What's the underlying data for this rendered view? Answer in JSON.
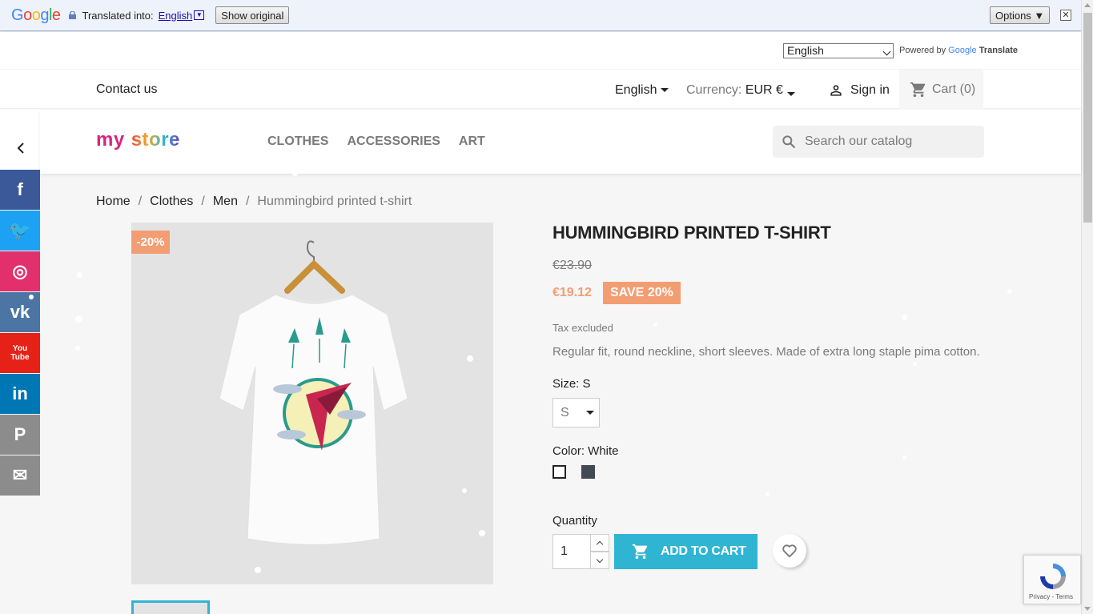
{
  "translate_bar": {
    "logo_letters": [
      {
        "ch": "G",
        "color": "#4285F4"
      },
      {
        "ch": "o",
        "color": "#EA4335"
      },
      {
        "ch": "o",
        "color": "#FBBC05"
      },
      {
        "ch": "g",
        "color": "#4285F4"
      },
      {
        "ch": "l",
        "color": "#34A853"
      },
      {
        "ch": "e",
        "color": "#EA4335"
      }
    ],
    "translated_into": "Translated into:",
    "language": "English",
    "show_original": "Show original",
    "options": "Options ▼",
    "close": "✕"
  },
  "translate_widget": {
    "selected_language": "English",
    "powered_by": "Powered by",
    "google": "Google",
    "translate": "Translate"
  },
  "header_nav": {
    "contact": "Contact us",
    "language": "English",
    "currency_label": "Currency:",
    "currency_value": "EUR €",
    "sign_in": "Sign in",
    "cart": "Cart (0)"
  },
  "logo": {
    "part1": "my",
    "part2": "store"
  },
  "menu": [
    "CLOTHES",
    "ACCESSORIES",
    "ART"
  ],
  "search": {
    "placeholder": "Search our catalog"
  },
  "social": [
    {
      "name": "facebook",
      "glyph": "f",
      "color": "#3b5998"
    },
    {
      "name": "twitter",
      "glyph": "🐦",
      "color": "#1da1f2"
    },
    {
      "name": "instagram",
      "glyph": "◎",
      "color": "#e1306c"
    },
    {
      "name": "vk",
      "glyph": "vk",
      "color": "#4c75a3"
    },
    {
      "name": "youtube",
      "glyph": "You\nTube",
      "color": "#e62117"
    },
    {
      "name": "linkedin",
      "glyph": "in",
      "color": "#0077b5"
    },
    {
      "name": "pinterest",
      "glyph": "P",
      "color": "#8c8c8c"
    },
    {
      "name": "email",
      "glyph": "✉",
      "color": "#8c8c8c"
    }
  ],
  "breadcrumb": {
    "items": [
      "Home",
      "Clothes",
      "Men"
    ],
    "separator": "/",
    "current": "Hummingbird printed t-shirt"
  },
  "product": {
    "discount_badge": "-20%",
    "title": "HUMMINGBIRD PRINTED T-SHIRT",
    "old_price": "€23.90",
    "price": "€19.12",
    "save_label": "SAVE 20%",
    "tax": "Tax excluded",
    "description": "Regular fit, round neckline, short sleeves. Made of extra long staple pima cotton.",
    "size_label": "Size: S",
    "size_value": "S",
    "color_label": "Color: White",
    "colors": [
      {
        "name": "White",
        "hex": "#ffffff"
      },
      {
        "name": "Black",
        "hex": "#434a54"
      }
    ],
    "quantity_label": "Quantity",
    "quantity": "1",
    "add_to_cart": "ADD TO CART"
  },
  "recaptcha": {
    "links": "Privacy - Terms"
  }
}
